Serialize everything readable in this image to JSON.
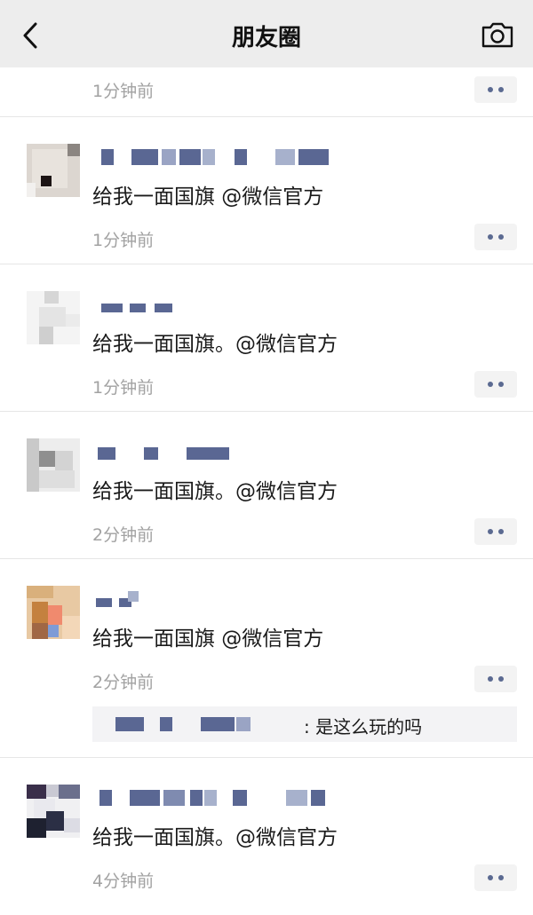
{
  "header": {
    "title": "朋友圈",
    "back_icon": "chevron-left-icon",
    "camera_icon": "camera-icon"
  },
  "colors": {
    "nav_bg": "#ededed",
    "timestamp": "#a2a2a2",
    "more_button_dots": "#5b6a91",
    "comment_bg": "#f3f3f5"
  },
  "posts": [
    {
      "content": "",
      "time": "1分钟前"
    },
    {
      "content": "给我一面国旗 @微信官方",
      "time": "1分钟前"
    },
    {
      "content": "给我一面国旗。@微信官方",
      "time": "1分钟前"
    },
    {
      "content": "给我一面国旗。@微信官方",
      "time": "2分钟前"
    },
    {
      "content": "给我一面国旗 @微信官方",
      "time": "2分钟前",
      "comment": ": 是这么玩的吗"
    },
    {
      "content": "给我一面国旗。@微信官方",
      "time": "4分钟前"
    }
  ]
}
